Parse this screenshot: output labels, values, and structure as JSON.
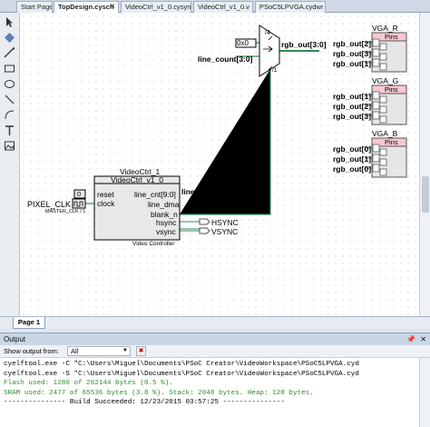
{
  "tabs": [
    {
      "label": "Start Page"
    },
    {
      "label": "TopDesign.cysch"
    },
    {
      "label": "VideoCtrl_v1_0.cysym"
    },
    {
      "label": "VideoCtrl_v1_0.v"
    },
    {
      "label": "PSoC5LPVGA.cydwr"
    }
  ],
  "schematic": {
    "mux": {
      "sel_const": "0x0",
      "width_label": "/4",
      "output_net": "rgb_out[3:0]",
      "input_net": "line_count[3:0]",
      "bus_width": "/1"
    },
    "ports": [
      {
        "title": "VGA_R",
        "header": "Pins",
        "rows": [
          "rgb_out[2]",
          "rgb_out[3]",
          "rgb_out[1]"
        ]
      },
      {
        "title": "VGA_G",
        "header": "Pins",
        "rows": [
          "rgb_out[1]",
          "rgb_out[2]",
          "rgb_out[3]"
        ]
      },
      {
        "title": "VGA_B",
        "header": "Pins",
        "rows": [
          "rgb_out[0]",
          "rgb_out[1]",
          "rgb_out[0]"
        ]
      }
    ],
    "component": {
      "instance": "VideoCtrl_1",
      "type": "VideoCtrl_v1_0",
      "left_pins": [
        "reset",
        "clock"
      ],
      "right_pins": [
        "line_cnt[9:0]",
        "line_dma",
        "blank_n",
        "hsync",
        "vsync"
      ],
      "footer": "Video Controller",
      "reset_const": "0"
    },
    "clock": {
      "label": "PIXEL_CLK",
      "sub_label": "MASTER_CLK / 1"
    },
    "nets": {
      "line_count": "line_count[9:0]",
      "hsync": "HSYNC",
      "vsync": "VSYNC"
    }
  },
  "page_tab": "Page 1",
  "output": {
    "title": "Output",
    "pin_icon": "pin-icon",
    "close_icon": "close-icon",
    "show_from_label": "Show output from:",
    "show_from_value": "All",
    "lines": [
      "cyelftool.exe -C \"C:\\Users\\Miguel\\Documents\\PSoC Creator\\VideoWorkspace\\PSoC5LPVGA.cyd",
      "cyelftool.exe -S \"C:\\Users\\Miguel\\Documents\\PSoC Creator\\VideoWorkspace\\PSoC5LPVGA.cyd",
      "Flash used: 1280 of 262144 bytes (0.5 %).",
      "SRAM used: 2477 of 65536 bytes (3.8 %). Stack: 2048 bytes. Heap: 128 bytes.",
      "--------------- Build Succeeded: 12/23/2015 03:57:25 ---------------"
    ]
  },
  "colors": {
    "wire": "#2e8b57",
    "pins_header": "#f7c8d0",
    "component_fill": "#e8e8e8"
  }
}
